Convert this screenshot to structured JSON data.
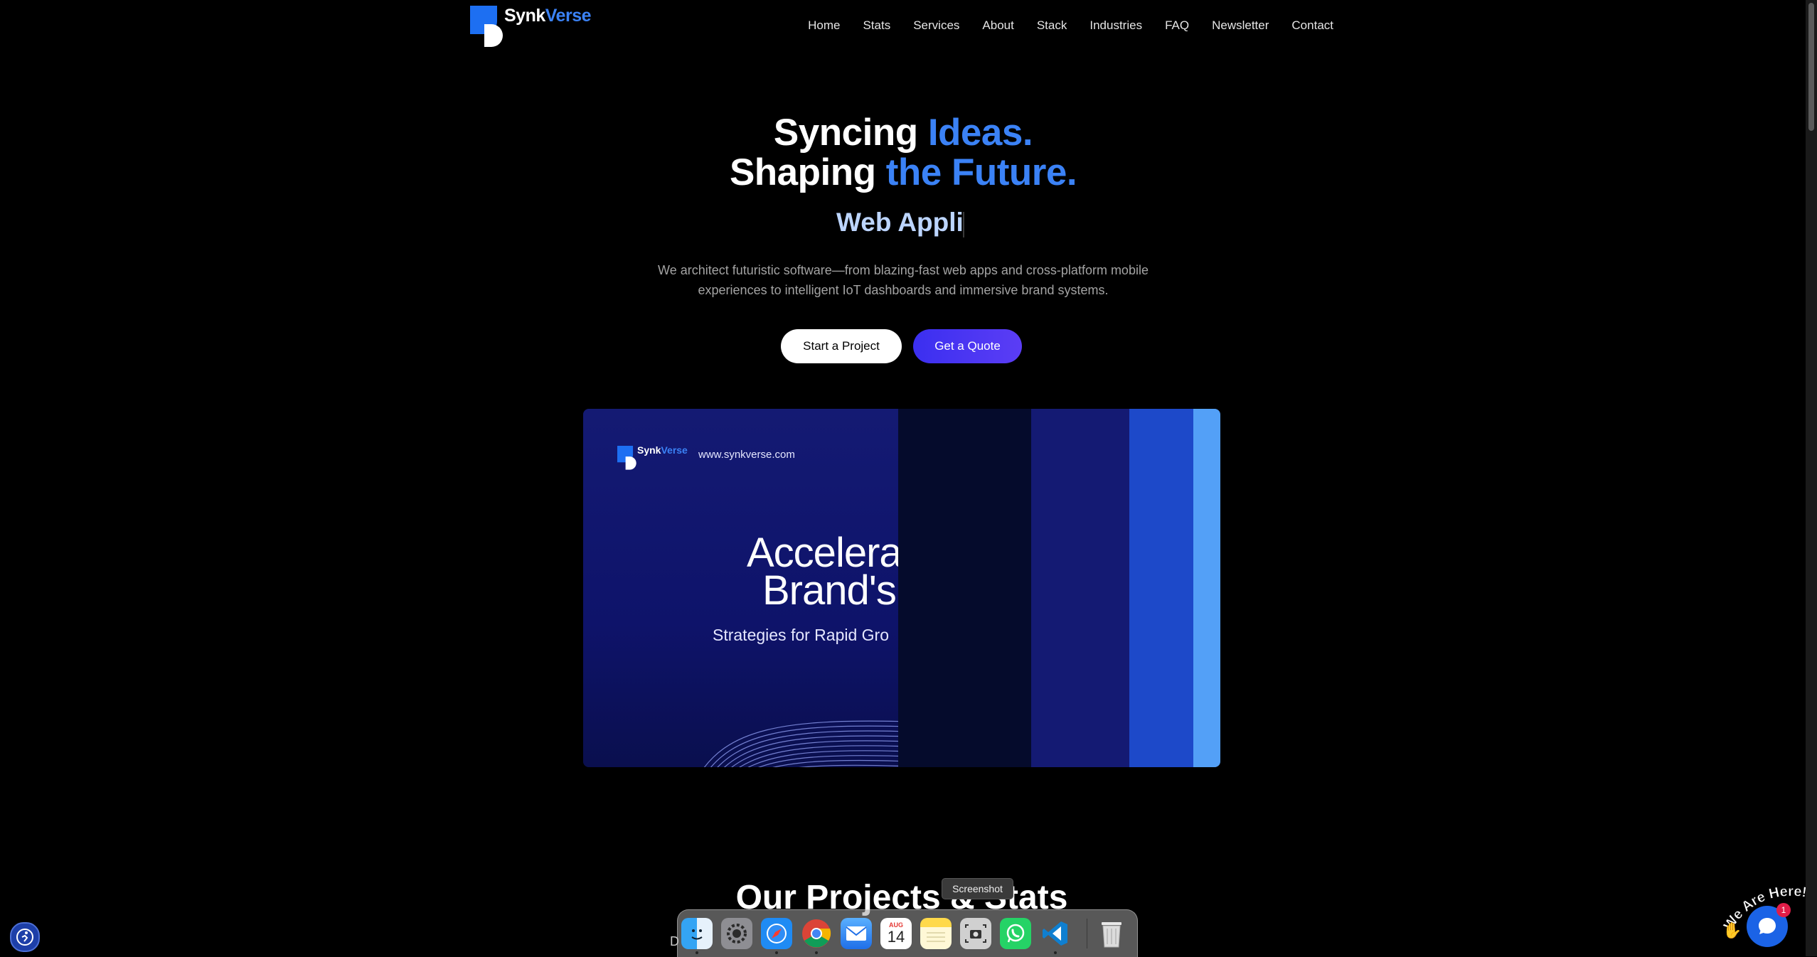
{
  "brand": {
    "name_part1": "Synk",
    "name_part2": "Verse"
  },
  "nav": {
    "items": [
      "Home",
      "Stats",
      "Services",
      "About",
      "Stack",
      "Industries",
      "FAQ",
      "Newsletter",
      "Contact"
    ]
  },
  "hero": {
    "line1_white": "Syncing ",
    "line1_blue": "Ideas.",
    "line2_white": "Shaping ",
    "line2_blue": "the Future.",
    "typed_text": "Web Appli",
    "lede": "We architect futuristic software—from blazing-fast web apps and cross-platform mobile experiences to intelligent IoT dashboards and immersive brand systems.",
    "primary_button": "Start a Project",
    "secondary_button": "Get a Quote"
  },
  "banner": {
    "logo_part1": "Synk",
    "logo_part2": "Verse",
    "url": "www.synkverse.com",
    "headline_line1": "Accelera",
    "headline_line2": "Brand's",
    "subhead": "Strategies for Rapid Gro"
  },
  "section": {
    "title": "Our Projects & Stats"
  },
  "dock": {
    "tooltip": "Screenshot",
    "partial_label": "D",
    "apps": [
      {
        "name": "finder",
        "icon": "finder-icon",
        "running": true
      },
      {
        "name": "system-settings",
        "icon": "gear-icon",
        "running": false
      },
      {
        "name": "safari",
        "icon": "compass-icon",
        "running": true
      },
      {
        "name": "chrome",
        "icon": "chrome-icon",
        "running": true
      },
      {
        "name": "mail",
        "icon": "mail-icon",
        "running": false
      },
      {
        "name": "calendar",
        "icon": "calendar-icon",
        "running": false,
        "month": "AUG",
        "day": "14"
      },
      {
        "name": "notes",
        "icon": "notes-icon",
        "running": false
      },
      {
        "name": "screenshot",
        "icon": "camera-icon",
        "running": false
      },
      {
        "name": "whatsapp",
        "icon": "whatsapp-icon",
        "running": false
      },
      {
        "name": "vscode",
        "icon": "vscode-icon",
        "running": true
      },
      {
        "name": "trash",
        "icon": "trash-icon",
        "running": false
      }
    ]
  },
  "widgets": {
    "we_are_here": "We Are Here!",
    "chat_badge": "1"
  },
  "colors": {
    "accent": "#3b82f6",
    "button_purple": "#4a36f2",
    "banner_navy": "#141a73"
  }
}
